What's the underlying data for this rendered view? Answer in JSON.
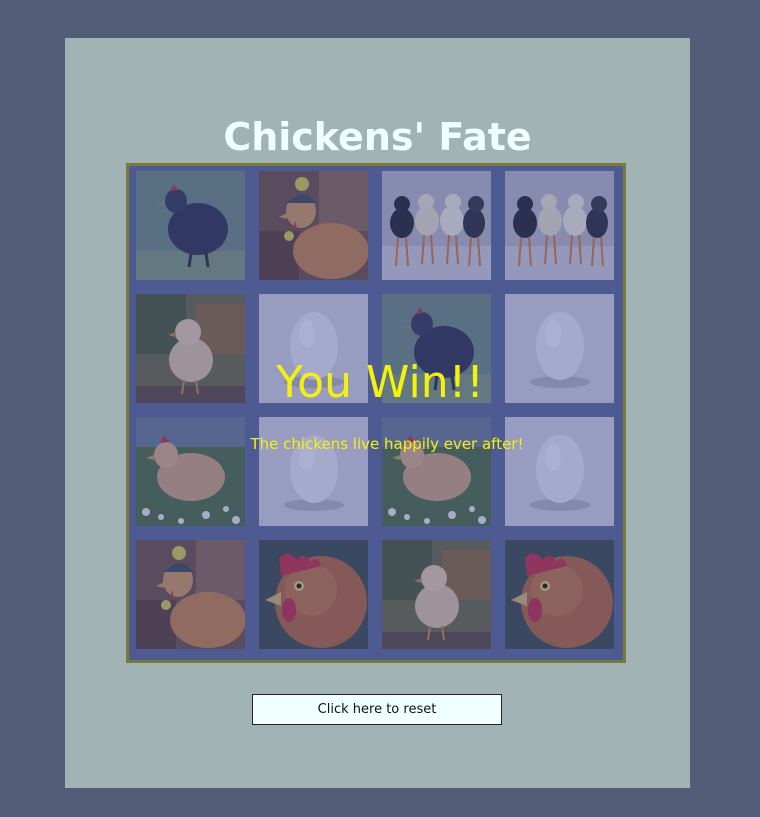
{
  "title": "Chickens' Fate",
  "win": {
    "title": "You Win!!",
    "subtitle": "The chickens live happily ever after!"
  },
  "reset_label": "Click here to reset",
  "colors": {
    "background": "#525d78",
    "panel": "#a2b3b5",
    "title": "#f0ffff",
    "win_text": "#f2f20c",
    "board_border": "#7a7a3a"
  },
  "board": {
    "rows": [
      [
        "black-hen",
        "hen-in-knit-hat",
        "four-chicks",
        "four-chicks"
      ],
      [
        "chick",
        "egg",
        "black-hen",
        "egg"
      ],
      [
        "hen-in-flowers",
        "egg",
        "hen-in-flowers",
        "egg"
      ],
      [
        "hen-in-knit-hat",
        "red-hen-closeup",
        "chick",
        "red-hen-closeup"
      ]
    ]
  }
}
